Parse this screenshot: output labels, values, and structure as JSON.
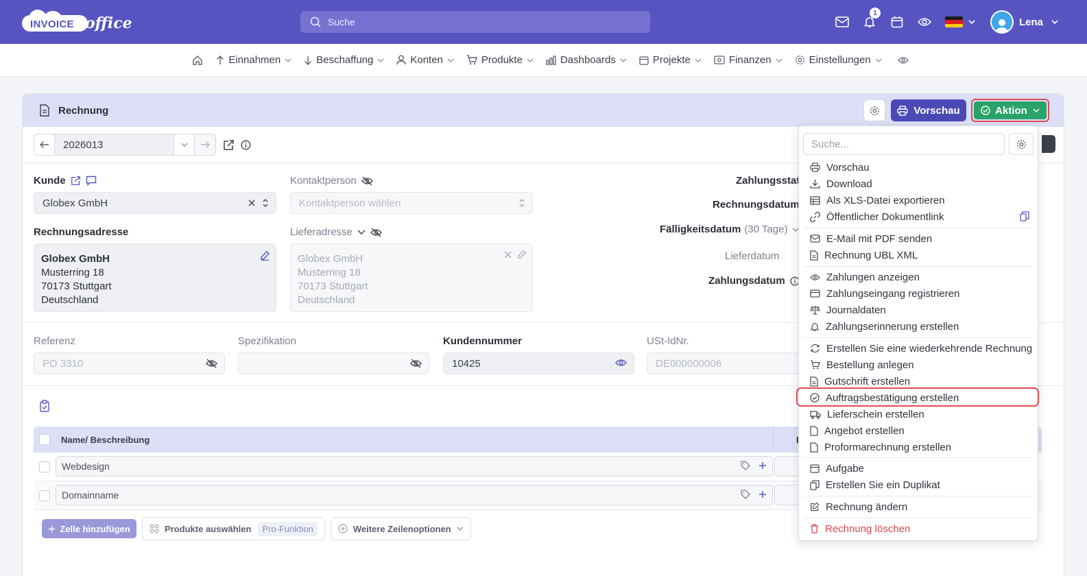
{
  "brand": {
    "logo_word1": "INVOICE",
    "logo_word2": "office"
  },
  "topbar": {
    "search_placeholder": "Suche",
    "notification_count": "1",
    "user_name": "Lena",
    "accent": "#5754c2"
  },
  "nav": [
    {
      "label": "Einnahmen",
      "icon": "arrow-up-icon"
    },
    {
      "label": "Beschaffung",
      "icon": "arrow-down-icon"
    },
    {
      "label": "Konten",
      "icon": "user-icon"
    },
    {
      "label": "Produkte",
      "icon": "cart-icon"
    },
    {
      "label": "Dashboards",
      "icon": "chart-icon"
    },
    {
      "label": "Projekte",
      "icon": "calendar-icon"
    },
    {
      "label": "Finanzen",
      "icon": "money-icon"
    },
    {
      "label": "Einstellungen",
      "icon": "gear-icon"
    }
  ],
  "card": {
    "title": "Rechnung",
    "preview_label": "Vorschau",
    "action_label": "Aktion",
    "invoice_number": "2026013"
  },
  "form": {
    "kunde_label": "Kunde",
    "kunde_value": "Globex GmbH",
    "kontakt_label": "Kontaktperson",
    "kontakt_placeholder": "Kontaktperson wählen",
    "rechnungsadresse_label": "Rechnungsadresse",
    "rechnungsadresse": {
      "l1": "Globex GmbH",
      "l2": "Musterring 18",
      "l3": "70173 Stuttgart",
      "l4": "Deutschland"
    },
    "lieferadresse_label": "Lieferadresse",
    "lieferadresse": {
      "l1": "Globex GmbH",
      "l2": "Musterring 18",
      "l3": "70173 Stuttgart",
      "l4": "Deutschland"
    },
    "zahlungsstatus_label": "Zahlungsstatus",
    "rechnungsdatum_label": "Rechnungsdatum",
    "faelligkeit_label": "Fälligkeitsdatum",
    "faelligkeit_days": "(30 Tage)",
    "lieferdatum_label": "Lieferdatum",
    "zahlungsdatum_label": "Zahlungsdatum",
    "referenz_label": "Referenz",
    "referenz_placeholder": "PO 3310",
    "spezifikation_label": "Spezifikation",
    "kundennummer_label": "Kundennummer",
    "kundennummer_value": "10425",
    "ustid_label": "USt-IdNr.",
    "ustid_placeholder": "DE000000006"
  },
  "table": {
    "header_name": "Name/ Beschreibung",
    "header_next": "I",
    "rows": [
      {
        "name": "Webdesign"
      },
      {
        "name": "Domainname"
      }
    ],
    "add_row_label": "Zelle hinzufügen",
    "select_products_label": "Produkte auswählen",
    "pro_badge": "Pro-Funktion",
    "more_options_label": "Weitere Zeilenoptionen"
  },
  "dropdown": {
    "search_placeholder": "Suche...",
    "items": [
      {
        "label": "Vorschau",
        "icon": "printer-icon"
      },
      {
        "label": "Download",
        "icon": "download-icon"
      },
      {
        "label": "Als XLS-Datei exportieren",
        "icon": "table-icon"
      },
      {
        "label": "Öffentlicher Dokumentlink",
        "icon": "link-icon"
      },
      {
        "label": "E-Mail mit PDF senden",
        "icon": "mail-icon"
      },
      {
        "label": "Rechnung UBL XML",
        "icon": "file-icon"
      },
      {
        "label": "Zahlungen anzeigen",
        "icon": "eye-icon"
      },
      {
        "label": "Zahlungseingang registrieren",
        "icon": "credit-card-icon"
      },
      {
        "label": "Journaldaten",
        "icon": "scale-icon"
      },
      {
        "label": "Zahlungserinnerung erstellen",
        "icon": "bell-icon"
      },
      {
        "label": "Erstellen Sie eine wiederkehrende Rechnung",
        "icon": "repeat-icon"
      },
      {
        "label": "Bestellung anlegen",
        "icon": "cart-icon"
      },
      {
        "label": "Gutschrift erstellen",
        "icon": "file-icon"
      },
      {
        "label": "Auftragsbestätigung erstellen",
        "icon": "check-circle-icon"
      },
      {
        "label": "Lieferschein erstellen",
        "icon": "truck-icon"
      },
      {
        "label": "Angebot erstellen",
        "icon": "file-icon"
      },
      {
        "label": "Proformarechnung erstellen",
        "icon": "file-icon"
      },
      {
        "label": "Aufgabe",
        "icon": "calendar-icon"
      },
      {
        "label": "Erstellen Sie ein Duplikat",
        "icon": "copy-icon"
      },
      {
        "label": "Rechnung ändern",
        "icon": "edit-icon"
      },
      {
        "label": "Rechnung löschen",
        "icon": "trash-icon"
      }
    ],
    "danger_color": "#e2454d",
    "highlight_color": "#e24b52"
  }
}
